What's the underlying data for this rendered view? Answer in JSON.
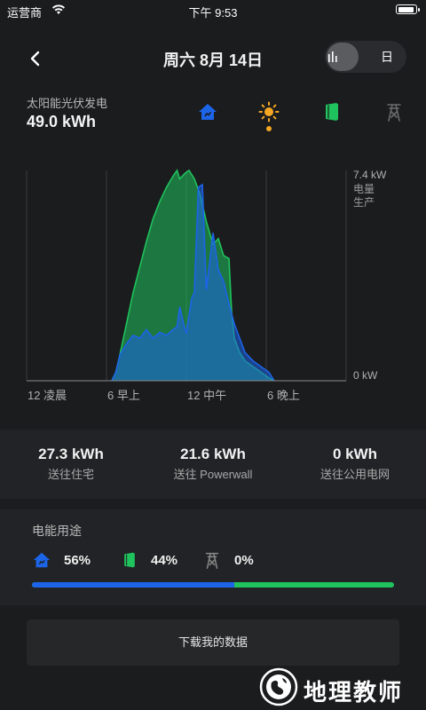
{
  "status": {
    "carrier": "运营商",
    "time": "下午 9:53"
  },
  "header": {
    "title": "周六 8月 14日",
    "toggle_day_label": "日"
  },
  "summary": {
    "label": "太阳能光伏发电",
    "value": "49.0 kWh"
  },
  "icons": {
    "home": "house-icon",
    "solar": "sun-icon",
    "powerwall": "powerwall-icon",
    "grid": "grid-tower-icon"
  },
  "colors": {
    "home": "#1c64e8",
    "powerwall": "#1fc25d",
    "solar": "#f5a623",
    "grid": "#6b6b6b",
    "background": "#1b1c1e"
  },
  "chart_data": {
    "type": "area",
    "x_unit": "hour",
    "xlim": [
      0,
      24
    ],
    "ylim": [
      0,
      7.4
    ],
    "y_ticks": [
      {
        "value": 7.4,
        "label": "7.4 kW"
      },
      {
        "value": 0,
        "label": "0 kW"
      }
    ],
    "y_title": "电量\n生产",
    "x_ticks": [
      {
        "value": 0,
        "label": "12 凌晨"
      },
      {
        "value": 6,
        "label": "6 早上"
      },
      {
        "value": 12,
        "label": "12 中午"
      },
      {
        "value": 18,
        "label": "6 晚上"
      }
    ],
    "series": [
      {
        "key": "total",
        "color": "#1fc25d",
        "x": [
          6.4,
          6.7,
          7.0,
          7.5,
          8.0,
          8.5,
          9.0,
          9.5,
          10.0,
          10.5,
          11.0,
          11.3,
          11.5,
          11.9,
          12.2,
          12.6,
          13.0,
          13.5,
          14.0,
          14.4,
          14.8,
          15.2,
          15.4,
          15.6,
          16.0,
          16.4,
          17.0,
          17.6,
          18.2,
          18.6
        ],
        "y": [
          0,
          0.3,
          0.9,
          2.0,
          3.1,
          4.0,
          4.9,
          5.7,
          6.3,
          6.8,
          7.2,
          7.4,
          7.1,
          7.3,
          7.4,
          7.1,
          6.6,
          5.6,
          4.8,
          5.0,
          4.4,
          4.3,
          2.4,
          1.5,
          1.0,
          0.7,
          0.5,
          0.3,
          0.1,
          0
        ]
      },
      {
        "key": "home",
        "color": "#1c64e8",
        "x": [
          6.4,
          6.7,
          7.0,
          7.5,
          8.0,
          8.5,
          9.0,
          9.5,
          10.0,
          10.5,
          11.0,
          11.3,
          11.5,
          11.9,
          12.0,
          12.2,
          12.4,
          12.6,
          12.9,
          13.2,
          13.5,
          13.8,
          14.0,
          14.4,
          14.8,
          15.2,
          15.6,
          16.0,
          16.4,
          17.0,
          17.6,
          18.2,
          18.6
        ],
        "y": [
          0,
          0.3,
          0.9,
          1.3,
          1.6,
          1.5,
          1.8,
          1.5,
          1.7,
          1.6,
          1.8,
          1.9,
          2.6,
          1.8,
          1.7,
          2.3,
          2.9,
          3.1,
          6.8,
          6.9,
          3.2,
          4.4,
          5.2,
          3.9,
          3.5,
          2.7,
          2.0,
          1.5,
          1.0,
          0.7,
          0.5,
          0.3,
          0
        ]
      }
    ]
  },
  "flows": [
    {
      "value": "27.3 kWh",
      "label": "送往住宅"
    },
    {
      "value": "21.6 kWh",
      "label": "送往 Powerwall"
    },
    {
      "value": "0 kWh",
      "label": "送往公用电网"
    }
  ],
  "usage": {
    "heading": "电能用途",
    "home_pct": "56%",
    "powerwall_pct": "44%",
    "grid_pct": "0%",
    "home_fraction": 0.56
  },
  "download_label": "下载我的数据",
  "watermark": "地理教师"
}
